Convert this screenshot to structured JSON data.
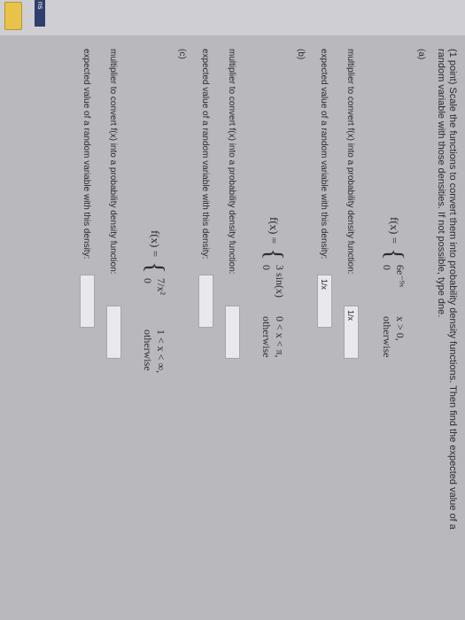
{
  "sidebar": {
    "tab_label": "ns"
  },
  "symbols": {
    "brace": "{"
  },
  "problem": {
    "intro_line1": "(1 point) Scale the functions to convert them into probability density functions. Then find the expected value of a",
    "intro_line2": "random variable with those densities. If not possible, type dne."
  },
  "parts": [
    {
      "label": "(a)",
      "lhs": "f(x) =",
      "case1_expr": "6e⁻⁹ˣ",
      "case1_cond": "x > 0,",
      "case2_expr": "0",
      "case2_cond": "otherwise",
      "multiplier_label": "multiplier to convert f(x) into a probability density function:",
      "multiplier_value": "1/x",
      "expected_label": "expected value of a random variable with this density:",
      "expected_value": "1/x"
    },
    {
      "label": "(b)",
      "lhs": "f(x) =",
      "case1_expr": "3 sin(x)",
      "case1_cond": "0 < x < π,",
      "case2_expr": "0",
      "case2_cond": "otherwise",
      "multiplier_label": "multiplier to convert f(x) into a probability density function:",
      "multiplier_value": "",
      "expected_label": "expected value of a random variable with this density:",
      "expected_value": ""
    },
    {
      "label": "(c)",
      "lhs": "f(x) =",
      "case1_expr": "7/x²",
      "case1_cond": "1 < x < ∞,",
      "case2_expr": "0",
      "case2_cond": "otherwise",
      "multiplier_label": "multiplier to convert f(x) into a probability density function:",
      "multiplier_value": "",
      "expected_label": "expected value of a random variable with this density:",
      "expected_value": ""
    }
  ]
}
